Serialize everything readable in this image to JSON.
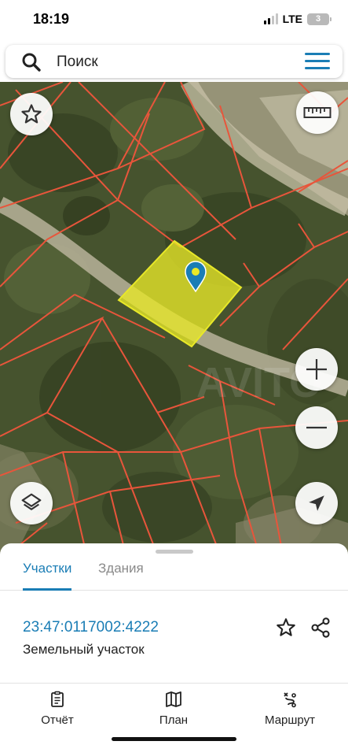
{
  "status_bar": {
    "time": "18:19",
    "network": "LTE",
    "battery": "3"
  },
  "search": {
    "placeholder": "Поиск",
    "icon": "search-icon",
    "menu_icon": "hamburger-menu-icon"
  },
  "map": {
    "selected_parcel_color": "#e8e828",
    "boundary_color": "#e8553b",
    "marker_color": "#1a7db5",
    "buttons": [
      "star-icon",
      "ruler-icon",
      "plus-icon",
      "minus-icon",
      "layers-icon",
      "navigation-arrow-icon"
    ]
  },
  "sheet": {
    "tabs": [
      {
        "label": "Участки",
        "active": true
      },
      {
        "label": "Здания",
        "active": false
      }
    ],
    "parcel": {
      "number": "23:47:0117002:4222",
      "type": "Земельный участок"
    },
    "nav": [
      {
        "label": "Отчёт",
        "icon": "report-icon"
      },
      {
        "label": "План",
        "icon": "map-plan-icon"
      },
      {
        "label": "Маршрут",
        "icon": "route-icon"
      }
    ]
  },
  "colors": {
    "accent": "#1a7db5"
  }
}
